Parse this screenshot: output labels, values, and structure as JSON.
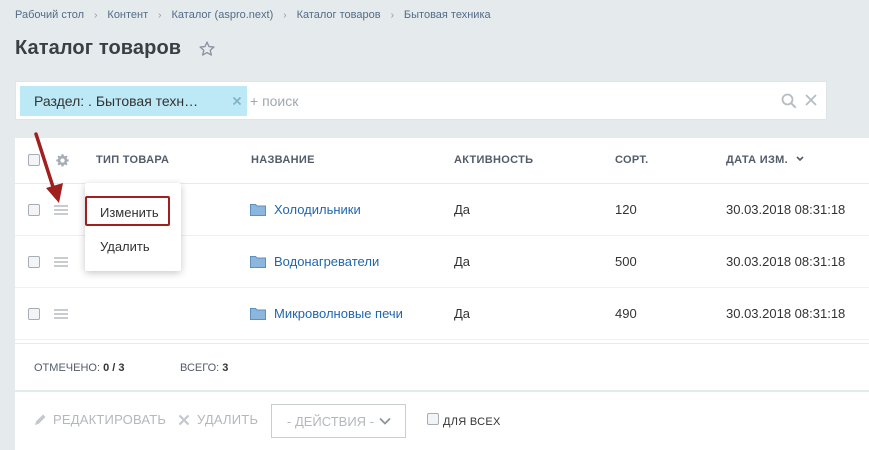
{
  "breadcrumbs": {
    "items": [
      "Рабочий стол",
      "Контент",
      "Каталог (aspro.next)",
      "Каталог товаров",
      "Бытовая техника"
    ],
    "separator": "›"
  },
  "page": {
    "title": "Каталог товаров"
  },
  "filter": {
    "chip_label": "Раздел: . Бытовая техн…",
    "search_placeholder": "+ поиск"
  },
  "grid": {
    "columns": {
      "type": "ТИП ТОВАРА",
      "name": "НАЗВАНИЕ",
      "active": "АКТИВНОСТЬ",
      "sort": "СОРТ.",
      "date": "ДАТА ИЗМ."
    },
    "rows": [
      {
        "name": "Холодильники",
        "active": "Да",
        "sort": "120",
        "date": "30.03.2018 08:31:18"
      },
      {
        "name": "Водонагреватели",
        "active": "Да",
        "sort": "500",
        "date": "30.03.2018 08:31:18"
      },
      {
        "name": "Микроволновые печи",
        "active": "Да",
        "sort": "490",
        "date": "30.03.2018 08:31:18"
      }
    ],
    "footer": {
      "selected_label": "ОТМЕЧЕНО:",
      "selected_value": "0 / 3",
      "total_label": "ВСЕГО:",
      "total_value": "3"
    }
  },
  "context_menu": {
    "edit": "Изменить",
    "delete": "Удалить"
  },
  "actions": {
    "edit": "РЕДАКТИРОВАТЬ",
    "delete": "УДАЛИТЬ",
    "select_value": "- ДЕЙСТВИЯ -",
    "for_all": "ДЛЯ ВСЕХ"
  },
  "colors": {
    "page_bg": "#e5eaed",
    "link": "#2067b0",
    "chip_bg": "#bde8f6",
    "annotation": "#a02020"
  }
}
